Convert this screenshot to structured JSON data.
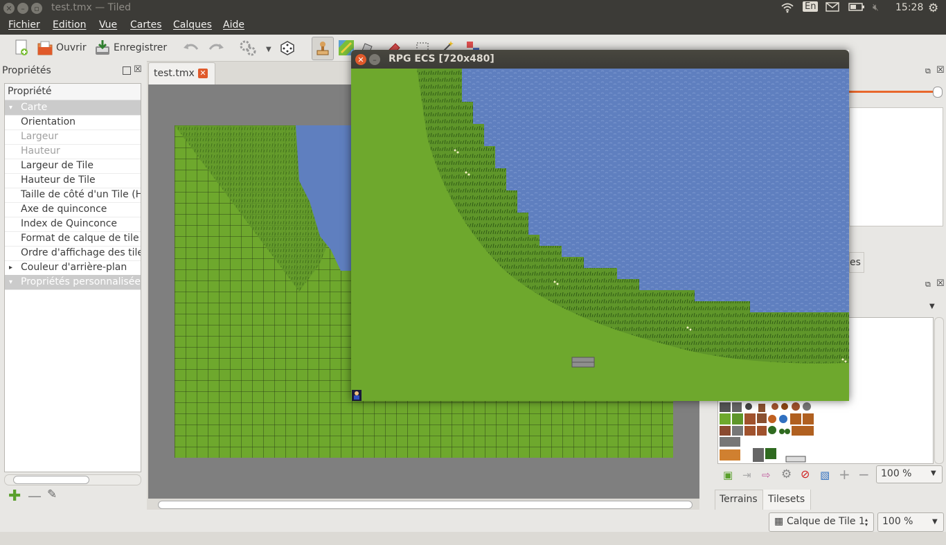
{
  "topbar": {
    "title": "test.tmx — Tiled",
    "lang": "En",
    "time": "15:28"
  },
  "menu": {
    "fichier": "Fichier",
    "edition": "Edition",
    "vue": "Vue",
    "cartes": "Cartes",
    "calques": "Calques",
    "aide": "Aide"
  },
  "toolbar": {
    "open_label": "Ouvrir",
    "save_label": "Enregistrer"
  },
  "properties": {
    "dock_title": "Propriétés",
    "column_header": "Propriété",
    "rows": [
      {
        "label": "Carte",
        "kind": "head"
      },
      {
        "label": "Orientation",
        "kind": "normal"
      },
      {
        "label": "Largeur",
        "kind": "disabled"
      },
      {
        "label": "Hauteur",
        "kind": "disabled"
      },
      {
        "label": "Largeur de Tile",
        "kind": "normal"
      },
      {
        "label": "Hauteur de Tile",
        "kind": "normal"
      },
      {
        "label": "Taille de côté d'un Tile (He",
        "kind": "normal"
      },
      {
        "label": "Axe de quinconce",
        "kind": "normal"
      },
      {
        "label": "Index de Quinconce",
        "kind": "normal"
      },
      {
        "label": "Format de calque de tile",
        "kind": "normal"
      },
      {
        "label": "Ordre d'affichage des tile",
        "kind": "normal"
      },
      {
        "label": "Couleur d'arrière-plan",
        "kind": "expand"
      },
      {
        "label": "Propriétés personnalisées",
        "kind": "head"
      }
    ]
  },
  "editor": {
    "tab_label": "test.tmx"
  },
  "game_window": {
    "title": "RPG ECS [720x480]"
  },
  "right_dock": {
    "partial_tab": "es",
    "zoom": "100 %",
    "tabs": {
      "terrains": "Terrains",
      "tilesets": "Tilesets"
    }
  },
  "statusbar": {
    "layer_select": "Calque de Tile 1",
    "zoom": "100 %"
  },
  "colors": {
    "grass": "#6ea82d",
    "water": "#5f7fbf",
    "panel": "#e8e7e4",
    "ubuntu_bar": "#3c3b37",
    "close_orange": "#e05a2b"
  }
}
